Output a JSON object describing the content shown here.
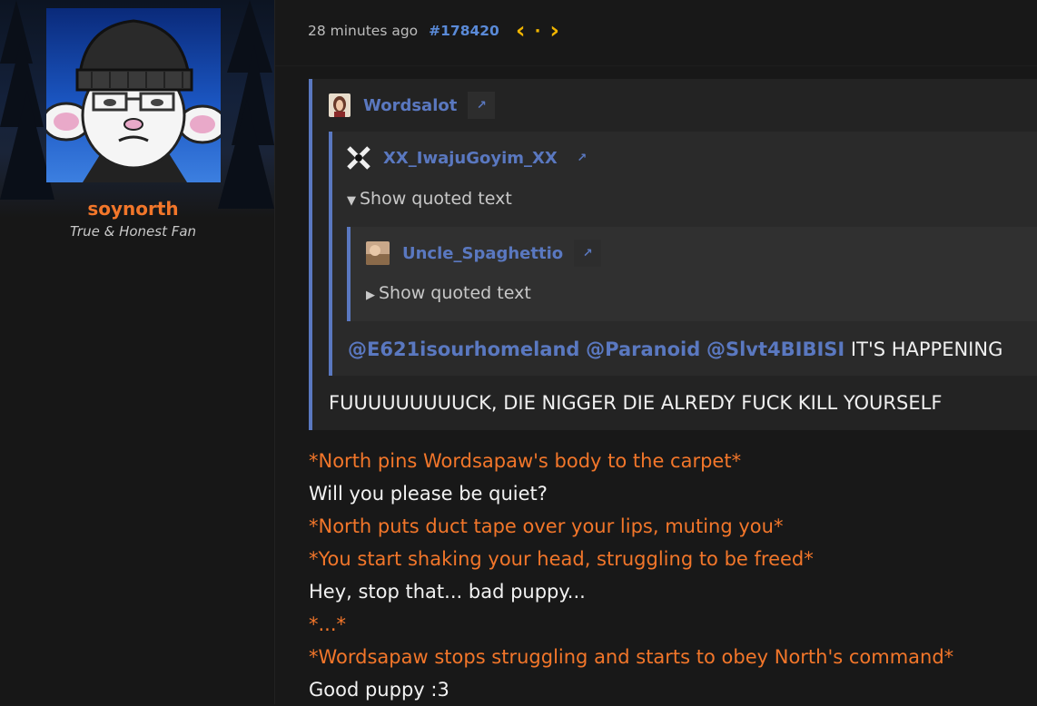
{
  "user": {
    "name": "soynorth",
    "title": "True & Honest Fan"
  },
  "post": {
    "time": "28 minutes ago",
    "number": "#178420",
    "nav_prev": "‹",
    "nav_dot": "·",
    "nav_next": "›"
  },
  "quotes": {
    "q1_author": "Wordsalot",
    "q2_author": "XX_IwajuGoyim_XX",
    "q2_show": "Show quoted text",
    "q3_author": "Uncle_Spaghettio",
    "q3_show": "Show quoted text",
    "mentions": [
      "@E621isourhomeland",
      "@Paranoid",
      "@Slvt4BIBISI"
    ],
    "mention_text": "IT'S HAPPENING",
    "q1_text": "FUUUUUUUUUCK, DIE NIGGER DIE ALREDY FUCK KILL YOURSELF",
    "link_icon": "↗"
  },
  "body": {
    "l1": "*North pins Wordsapaw's body to the carpet*",
    "l2": "Will you please be quiet?",
    "l3": "*North puts duct tape over your lips, muting you*",
    "l4": "*You start shaking your head, struggling to be freed*",
    "l5": "Hey, stop that... bad puppy...",
    "l6": "*...*",
    "l7": "*Wordsapaw stops struggling and starts to obey North's command*",
    "l8": "Good puppy :3"
  },
  "colors": {
    "accent_orange": "#f2762a",
    "link_blue": "#5a78c0",
    "nav_yellow": "#f0b400"
  }
}
